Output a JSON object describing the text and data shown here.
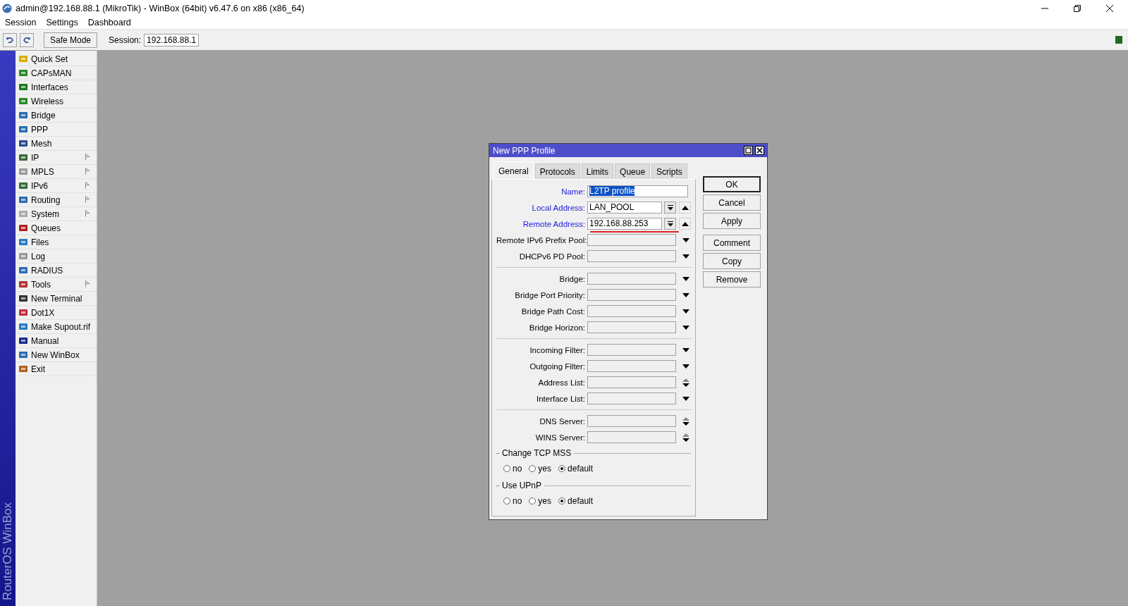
{
  "window": {
    "title": "admin@192.168.88.1 (MikroTik) - WinBox (64bit) v6.47.6 on x86 (x86_64)"
  },
  "menu": [
    "Session",
    "Settings",
    "Dashboard"
  ],
  "toolbar": {
    "safe_mode": "Safe Mode",
    "session_label": "Session:",
    "session_value": "192.168.88.1"
  },
  "sidebar": {
    "brand": "RouterOS WinBox",
    "items": [
      {
        "label": "Quick Set",
        "has_submenu": false
      },
      {
        "label": "CAPsMAN",
        "has_submenu": false
      },
      {
        "label": "Interfaces",
        "has_submenu": false
      },
      {
        "label": "Wireless",
        "has_submenu": false
      },
      {
        "label": "Bridge",
        "has_submenu": false
      },
      {
        "label": "PPP",
        "has_submenu": false
      },
      {
        "label": "Mesh",
        "has_submenu": false
      },
      {
        "label": "IP",
        "has_submenu": true
      },
      {
        "label": "MPLS",
        "has_submenu": true
      },
      {
        "label": "IPv6",
        "has_submenu": true
      },
      {
        "label": "Routing",
        "has_submenu": true
      },
      {
        "label": "System",
        "has_submenu": true
      },
      {
        "label": "Queues",
        "has_submenu": false
      },
      {
        "label": "Files",
        "has_submenu": false
      },
      {
        "label": "Log",
        "has_submenu": false
      },
      {
        "label": "RADIUS",
        "has_submenu": false
      },
      {
        "label": "Tools",
        "has_submenu": true
      },
      {
        "label": "New Terminal",
        "has_submenu": false
      },
      {
        "label": "Dot1X",
        "has_submenu": false
      },
      {
        "label": "Make Supout.rif",
        "has_submenu": false
      },
      {
        "label": "Manual",
        "has_submenu": false
      },
      {
        "label": "New WinBox",
        "has_submenu": false
      },
      {
        "label": "Exit",
        "has_submenu": false
      }
    ]
  },
  "dialog": {
    "title": "New PPP Profile",
    "tabs": [
      {
        "label": "General",
        "selected": true
      },
      {
        "label": "Protocols",
        "selected": false
      },
      {
        "label": "Limits",
        "selected": false
      },
      {
        "label": "Queue",
        "selected": false
      },
      {
        "label": "Scripts",
        "selected": false
      }
    ],
    "groups": [
      [
        {
          "label": "Name:",
          "value": "L2TP profile",
          "kind": "text",
          "set": true,
          "value_selected": true
        },
        {
          "label": "Local Address:",
          "value": "LAN_POOL",
          "kind": "combo",
          "set": true
        },
        {
          "label": "Remote Address:",
          "value": "192.168.88.253",
          "kind": "combo",
          "set": true,
          "underlined": true
        },
        {
          "label": "Remote IPv6 Prefix Pool:",
          "kind": "dropdown",
          "set": false
        },
        {
          "label": "DHCPv6 PD Pool:",
          "kind": "dropdown",
          "set": false
        }
      ],
      [
        {
          "label": "Bridge:",
          "kind": "dropdown",
          "set": false
        },
        {
          "label": "Bridge Port Priority:",
          "kind": "dropdown",
          "set": false
        },
        {
          "label": "Bridge Path Cost:",
          "kind": "dropdown",
          "set": false
        },
        {
          "label": "Bridge Horizon:",
          "kind": "dropdown",
          "set": false
        }
      ],
      [
        {
          "label": "Incoming Filter:",
          "kind": "dropdown",
          "set": false
        },
        {
          "label": "Outgoing Filter:",
          "kind": "dropdown",
          "set": false
        },
        {
          "label": "Address List:",
          "kind": "updown",
          "set": false
        },
        {
          "label": "Interface List:",
          "kind": "dropdown",
          "set": false
        }
      ],
      [
        {
          "label": "DNS Server:",
          "kind": "updown",
          "set": false
        },
        {
          "label": "WINS Server:",
          "kind": "updown",
          "set": false
        }
      ]
    ],
    "radio_groups": [
      {
        "title": "Change TCP MSS",
        "options": [
          {
            "label": "no",
            "selected": false
          },
          {
            "label": "yes",
            "selected": false
          },
          {
            "label": "default",
            "selected": true
          }
        ]
      },
      {
        "title": "Use UPnP",
        "options": [
          {
            "label": "no",
            "selected": false
          },
          {
            "label": "yes",
            "selected": false
          },
          {
            "label": "default",
            "selected": true
          }
        ]
      }
    ],
    "buttons": [
      {
        "label": "OK",
        "default": true
      },
      {
        "label": "Cancel",
        "default": false
      },
      {
        "label": "Apply",
        "default": false
      },
      {
        "label": "Comment",
        "default": false
      },
      {
        "label": "Copy",
        "default": false
      },
      {
        "label": "Remove",
        "default": false
      }
    ]
  }
}
